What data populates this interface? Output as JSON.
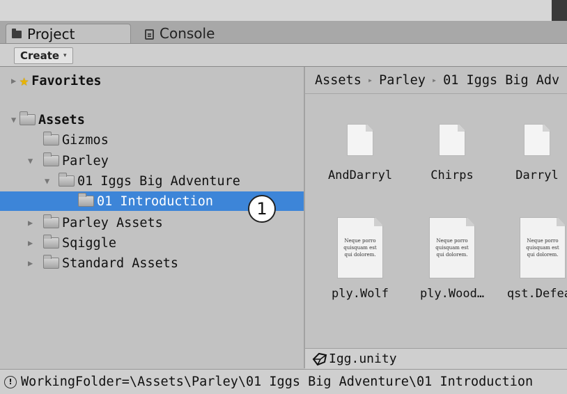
{
  "tabs": [
    {
      "label": "Project",
      "icon": "folder-icon",
      "active": true
    },
    {
      "label": "Console",
      "icon": "console-icon",
      "active": false
    }
  ],
  "toolbar": {
    "create_label": "Create",
    "create_arrow": "▾"
  },
  "tree": {
    "favorites": "Favorites",
    "assets": "Assets",
    "gizmos": "Gizmos",
    "parley": "Parley",
    "iggs": "01 Iggs Big Adventure",
    "intro": "01 Introduction",
    "parley_assets": "Parley Assets",
    "sqiggle": "Sqiggle",
    "standard_assets": "Standard Assets"
  },
  "badge": "1",
  "breadcrumb": [
    "Assets",
    "Parley",
    "01 Iggs Big Adv"
  ],
  "breadcrumb_sep": "▸",
  "assets_grid": [
    {
      "name": "AndDarryl",
      "type": "blank"
    },
    {
      "name": "Chirps",
      "type": "blank"
    },
    {
      "name": "Darryl",
      "type": "blank"
    },
    {
      "name": "ply.Wolf",
      "type": "script"
    },
    {
      "name": "ply.Wood…",
      "type": "script"
    },
    {
      "name": "qst.Defeat",
      "type": "script"
    }
  ],
  "script_preview": [
    "Neque porro",
    "quisquam est",
    "qui dolorem."
  ],
  "selected_asset": "Igg.unity",
  "status_text": "WorkingFolder=\\Assets\\Parley\\01 Iggs Big Adventure\\01 Introduction",
  "colors": {
    "selection": "#3d85d8",
    "panel": "#c2c2c2"
  }
}
